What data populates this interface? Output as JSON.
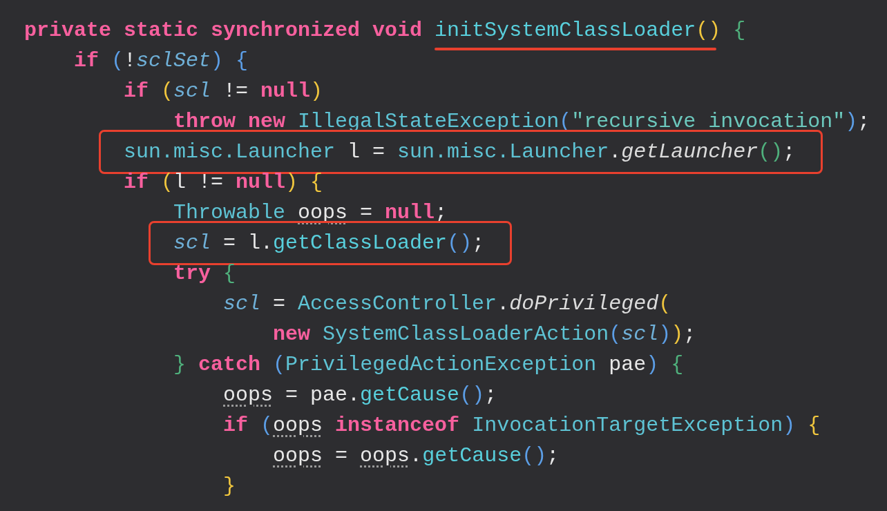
{
  "editor": {
    "lines": [
      {
        "boxed": false,
        "tokens": [
          {
            "text": "private static synchronized void ",
            "kind": "kw"
          },
          {
            "text": "initSystemClassLoader",
            "kind": "fn",
            "marked": true
          },
          {
            "text": "()",
            "kind": "p3"
          },
          {
            "text": " {",
            "kind": "p1"
          }
        ]
      },
      {
        "boxed": false,
        "tokens": [
          {
            "text": "    if ",
            "kind": "kw"
          },
          {
            "text": "(",
            "kind": "p2"
          },
          {
            "text": "!",
            "kind": "plain"
          },
          {
            "text": "sclSet",
            "kind": "var"
          },
          {
            "text": ")",
            "kind": "p2"
          },
          {
            "text": " {",
            "kind": "p2"
          }
        ]
      },
      {
        "boxed": false,
        "tokens": [
          {
            "text": "        if ",
            "kind": "kw"
          },
          {
            "text": "(",
            "kind": "p3"
          },
          {
            "text": "scl",
            "kind": "var"
          },
          {
            "text": " != ",
            "kind": "plain"
          },
          {
            "text": "null",
            "kind": "kw"
          },
          {
            "text": ")",
            "kind": "p3"
          }
        ]
      },
      {
        "boxed": false,
        "tokens": [
          {
            "text": "            throw new ",
            "kind": "kw"
          },
          {
            "text": "IllegalStateException",
            "kind": "type"
          },
          {
            "text": "(",
            "kind": "p2"
          },
          {
            "text": "\"recursive invocation\"",
            "kind": "str"
          },
          {
            "text": ")",
            "kind": "p2"
          },
          {
            "text": ";",
            "kind": "plain"
          }
        ]
      },
      {
        "boxed": true,
        "tokens": [
          {
            "text": "        sun.misc.Launcher",
            "kind": "type"
          },
          {
            "text": " l = ",
            "kind": "plain"
          },
          {
            "text": "sun.misc.Launcher",
            "kind": "type"
          },
          {
            "text": ".",
            "kind": "plain"
          },
          {
            "text": "getLauncher",
            "kind": "static_call"
          },
          {
            "text": "()",
            "kind": "p1"
          },
          {
            "text": ";",
            "kind": "plain"
          }
        ]
      },
      {
        "boxed": false,
        "tokens": [
          {
            "text": "        if ",
            "kind": "kw"
          },
          {
            "text": "(",
            "kind": "p3"
          },
          {
            "text": "l != ",
            "kind": "plain"
          },
          {
            "text": "null",
            "kind": "kw"
          },
          {
            "text": ")",
            "kind": "p3"
          },
          {
            "text": " {",
            "kind": "p3"
          }
        ]
      },
      {
        "boxed": false,
        "tokens": [
          {
            "text": "            Throwable ",
            "kind": "type"
          },
          {
            "text": "oops",
            "kind": "under"
          },
          {
            "text": " = ",
            "kind": "plain"
          },
          {
            "text": "null",
            "kind": "kw"
          },
          {
            "text": ";",
            "kind": "plain"
          }
        ]
      },
      {
        "boxed": true,
        "tokens": [
          {
            "text": "            scl",
            "kind": "var"
          },
          {
            "text": " = l.",
            "kind": "plain"
          },
          {
            "text": "getClassLoader",
            "kind": "fn"
          },
          {
            "text": "()",
            "kind": "p2"
          },
          {
            "text": ";",
            "kind": "plain"
          }
        ]
      },
      {
        "boxed": false,
        "tokens": [
          {
            "text": "            try ",
            "kind": "kw"
          },
          {
            "text": "{",
            "kind": "p1"
          }
        ]
      },
      {
        "boxed": false,
        "tokens": [
          {
            "text": "                scl",
            "kind": "var"
          },
          {
            "text": " = ",
            "kind": "plain"
          },
          {
            "text": "AccessController",
            "kind": "type"
          },
          {
            "text": ".",
            "kind": "plain"
          },
          {
            "text": "doPrivileged",
            "kind": "static_call"
          },
          {
            "text": "(",
            "kind": "p3"
          }
        ]
      },
      {
        "boxed": false,
        "tokens": [
          {
            "text": "                    new ",
            "kind": "kw"
          },
          {
            "text": "SystemClassLoaderAction",
            "kind": "type"
          },
          {
            "text": "(",
            "kind": "p2"
          },
          {
            "text": "scl",
            "kind": "var"
          },
          {
            "text": ")",
            "kind": "p2"
          },
          {
            "text": ")",
            "kind": "p3"
          },
          {
            "text": ";",
            "kind": "plain"
          }
        ]
      },
      {
        "boxed": false,
        "tokens": [
          {
            "text": "            }",
            "kind": "p1"
          },
          {
            "text": " catch ",
            "kind": "kw"
          },
          {
            "text": "(",
            "kind": "p2"
          },
          {
            "text": "PrivilegedActionException",
            "kind": "type"
          },
          {
            "text": " pae",
            "kind": "plain"
          },
          {
            "text": ")",
            "kind": "p2"
          },
          {
            "text": " {",
            "kind": "p1"
          }
        ]
      },
      {
        "boxed": false,
        "tokens": [
          {
            "text": "                oops",
            "kind": "under"
          },
          {
            "text": " = pae.",
            "kind": "plain"
          },
          {
            "text": "getCause",
            "kind": "fn"
          },
          {
            "text": "()",
            "kind": "p2"
          },
          {
            "text": ";",
            "kind": "plain"
          }
        ]
      },
      {
        "boxed": false,
        "tokens": [
          {
            "text": "                if ",
            "kind": "kw"
          },
          {
            "text": "(",
            "kind": "p2"
          },
          {
            "text": "oops",
            "kind": "under"
          },
          {
            "text": " instanceof ",
            "kind": "kw"
          },
          {
            "text": "InvocationTargetException",
            "kind": "type"
          },
          {
            "text": ")",
            "kind": "p2"
          },
          {
            "text": " {",
            "kind": "p3"
          }
        ]
      },
      {
        "boxed": false,
        "tokens": [
          {
            "text": "                    oops",
            "kind": "under"
          },
          {
            "text": " = ",
            "kind": "plain"
          },
          {
            "text": "oops",
            "kind": "under"
          },
          {
            "text": ".",
            "kind": "plain"
          },
          {
            "text": "getCause",
            "kind": "fn"
          },
          {
            "text": "()",
            "kind": "p2"
          },
          {
            "text": ";",
            "kind": "plain"
          }
        ]
      },
      {
        "boxed": false,
        "tokens": [
          {
            "text": "                }",
            "kind": "p3"
          }
        ]
      }
    ]
  }
}
